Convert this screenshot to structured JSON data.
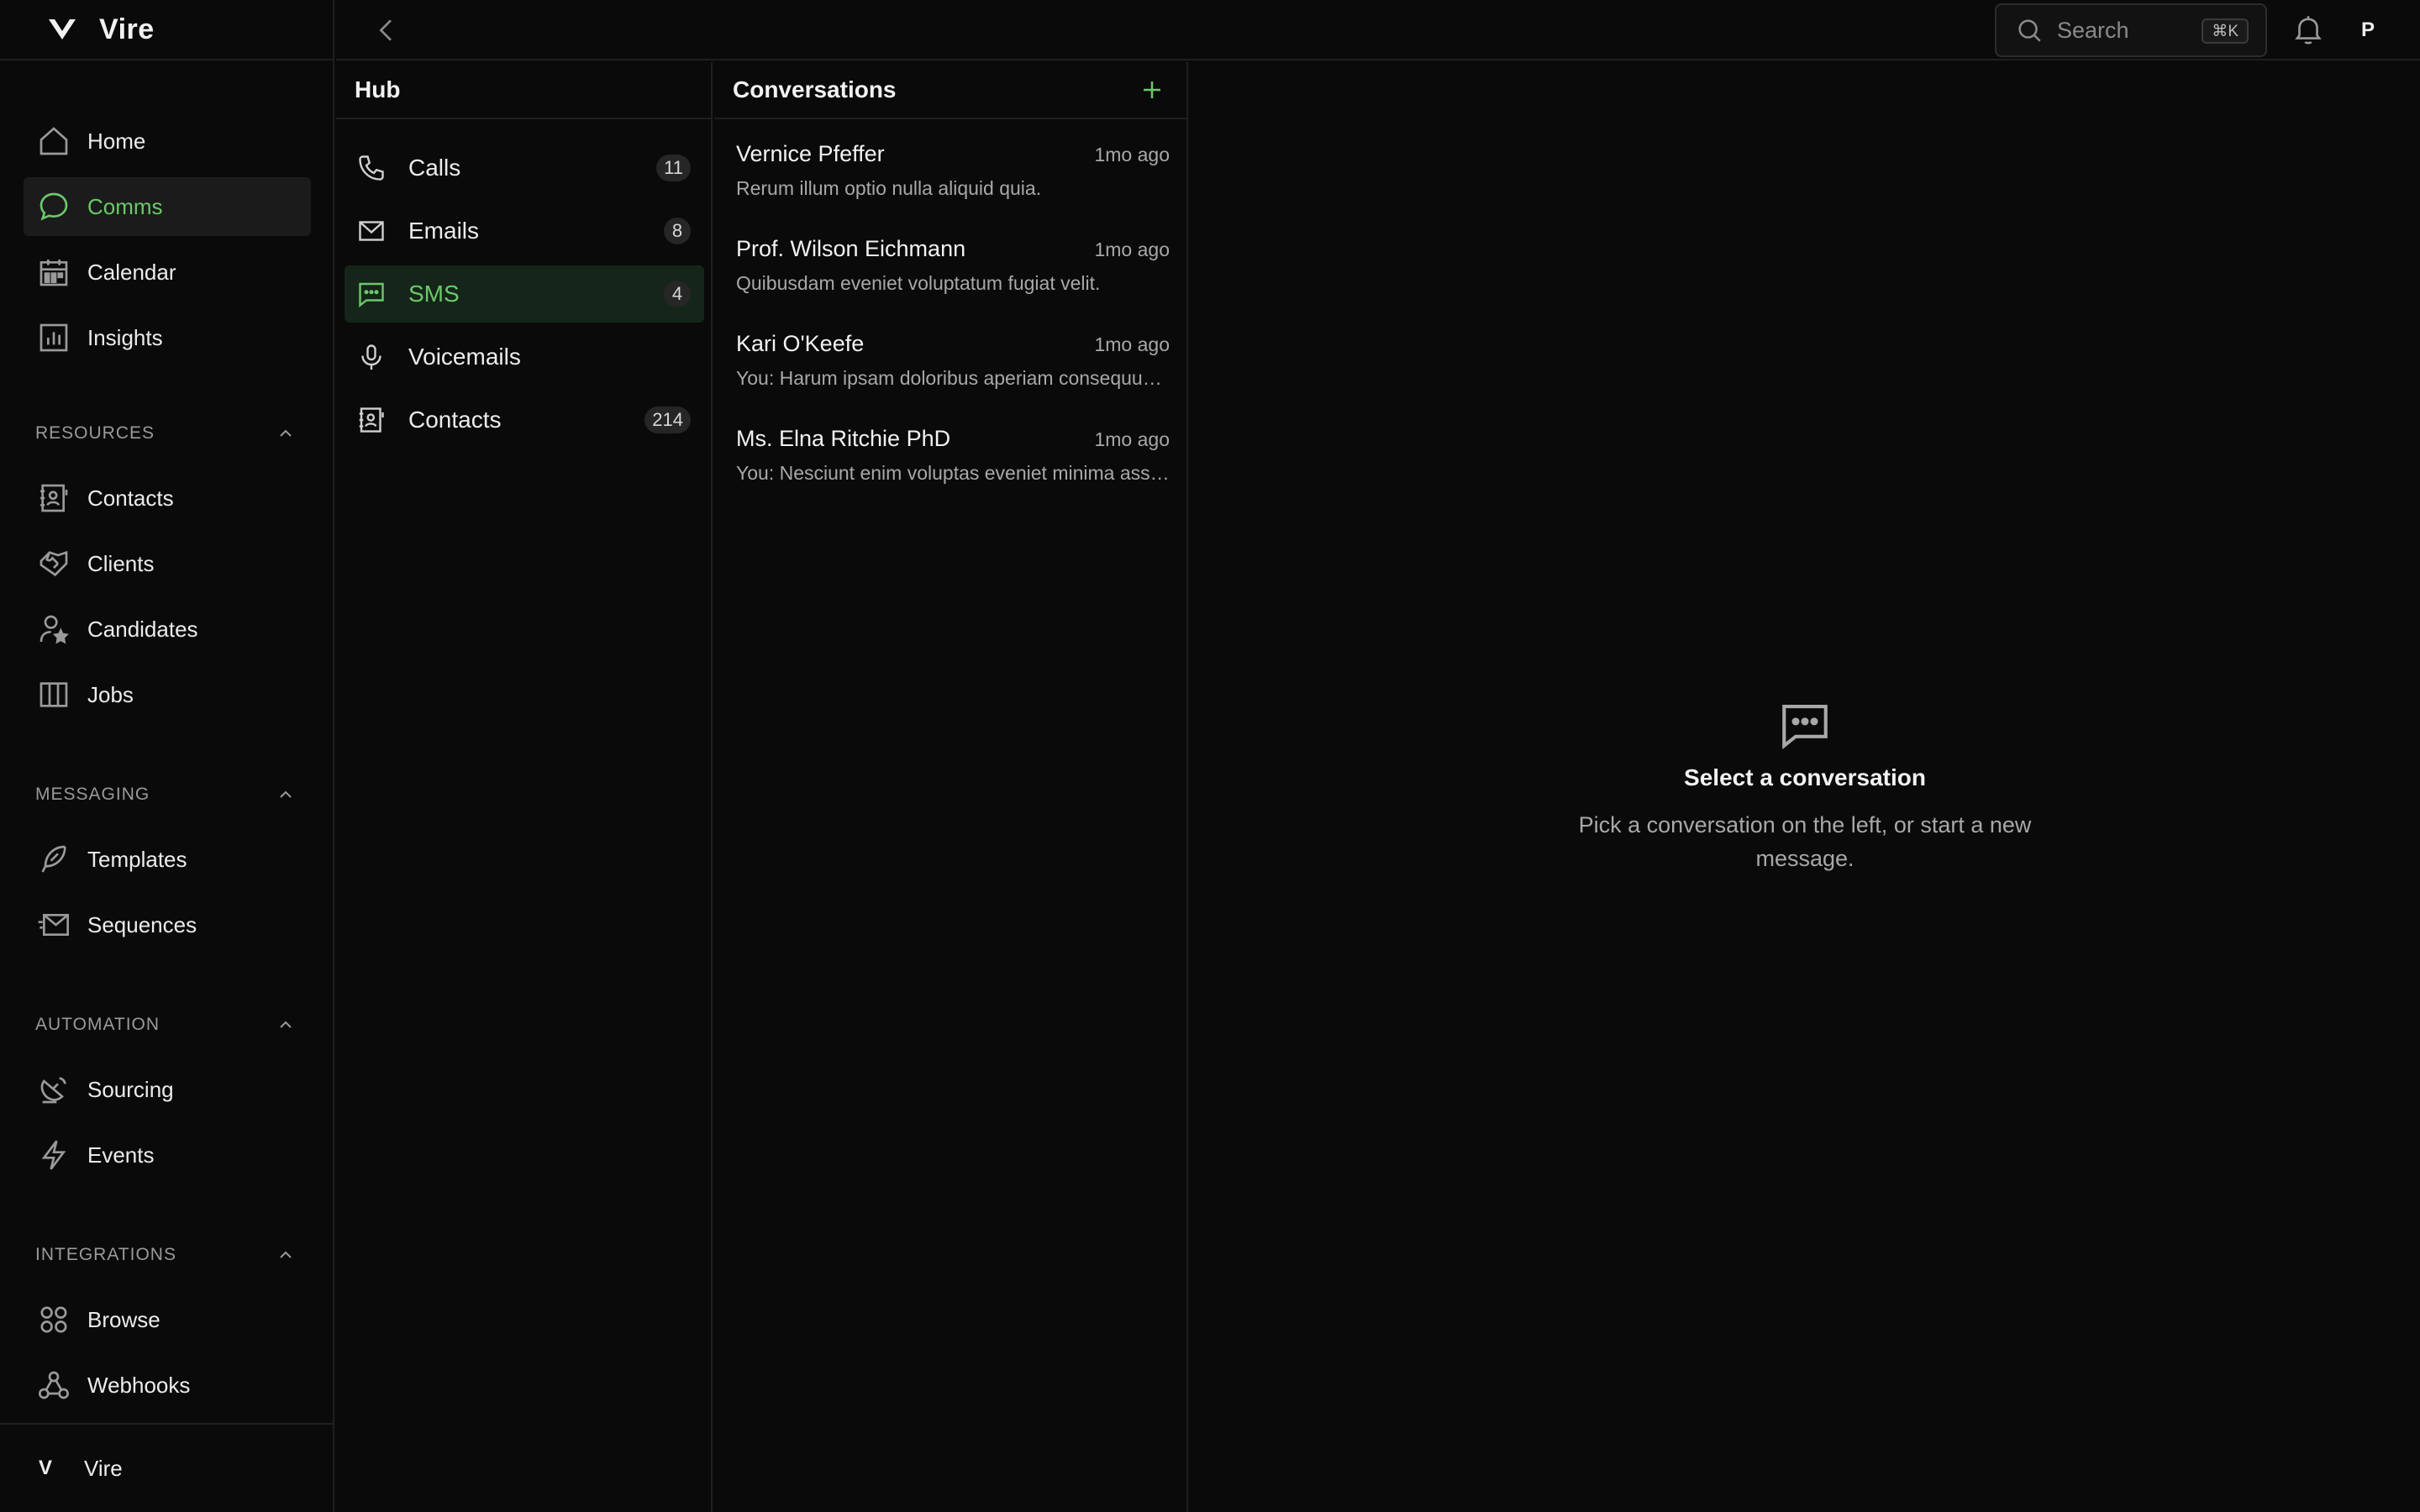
{
  "brand": {
    "name": "Vire",
    "footer_mark": "V",
    "footer_name": "Vire"
  },
  "nav": [
    {
      "label": "Home",
      "icon": "home-icon",
      "active": false
    },
    {
      "label": "Comms",
      "icon": "chat-bubble-icon",
      "active": true
    },
    {
      "label": "Calendar",
      "icon": "calendar-icon",
      "active": false
    },
    {
      "label": "Insights",
      "icon": "bar-chart-icon",
      "active": false
    }
  ],
  "sections": {
    "resources": {
      "title": "RESOURCES",
      "items": [
        {
          "label": "Contacts",
          "icon": "contact-book-icon"
        },
        {
          "label": "Clients",
          "icon": "handshake-icon"
        },
        {
          "label": "Candidates",
          "icon": "user-star-icon"
        },
        {
          "label": "Jobs",
          "icon": "columns-icon"
        }
      ]
    },
    "messaging": {
      "title": "MESSAGING",
      "items": [
        {
          "label": "Templates",
          "icon": "feather-icon"
        },
        {
          "label": "Sequences",
          "icon": "mail-send-icon"
        }
      ]
    },
    "automation": {
      "title": "AUTOMATION",
      "items": [
        {
          "label": "Sourcing",
          "icon": "satellite-dish-icon"
        },
        {
          "label": "Events",
          "icon": "lightning-icon"
        }
      ]
    },
    "integrations": {
      "title": "INTEGRATIONS",
      "items": [
        {
          "label": "Browse",
          "icon": "grid-circles-icon"
        },
        {
          "label": "Webhooks",
          "icon": "webhook-icon"
        }
      ]
    }
  },
  "topbar": {
    "search_placeholder": "Search",
    "search_shortcut": "⌘K",
    "avatar_initial": "P"
  },
  "hub": {
    "title": "Hub",
    "items": [
      {
        "label": "Calls",
        "count": "11",
        "icon": "phone-icon",
        "active": false
      },
      {
        "label": "Emails",
        "count": "8",
        "icon": "envelope-icon",
        "active": false
      },
      {
        "label": "SMS",
        "count": "4",
        "icon": "sms-icon",
        "active": true
      },
      {
        "label": "Voicemails",
        "count": "",
        "icon": "microphone-icon",
        "active": false
      },
      {
        "label": "Contacts",
        "count": "214",
        "icon": "contact-book-icon",
        "active": false
      }
    ]
  },
  "conversations": {
    "title": "Conversations",
    "items": [
      {
        "name": "Vernice Pfeffer",
        "time": "1mo ago",
        "preview": "Rerum illum optio nulla aliquid quia."
      },
      {
        "name": "Prof. Wilson Eichmann",
        "time": "1mo ago",
        "preview": "Quibusdam eveniet voluptatum fugiat velit."
      },
      {
        "name": "Kari O'Keefe",
        "time": "1mo ago",
        "preview": "You: Harum ipsam doloribus aperiam consequuntur."
      },
      {
        "name": "Ms. Elna Ritchie PhD",
        "time": "1mo ago",
        "preview": "You: Nesciunt enim voluptas eveniet minima assumenda."
      }
    ]
  },
  "empty_state": {
    "title": "Select a conversation",
    "description": "Pick a conversation on the left, or start a new message."
  },
  "colors": {
    "accent": "#6cc86a",
    "background": "#0a0a0a",
    "border": "#1f1f1f",
    "muted_text": "#a8a8a8"
  }
}
